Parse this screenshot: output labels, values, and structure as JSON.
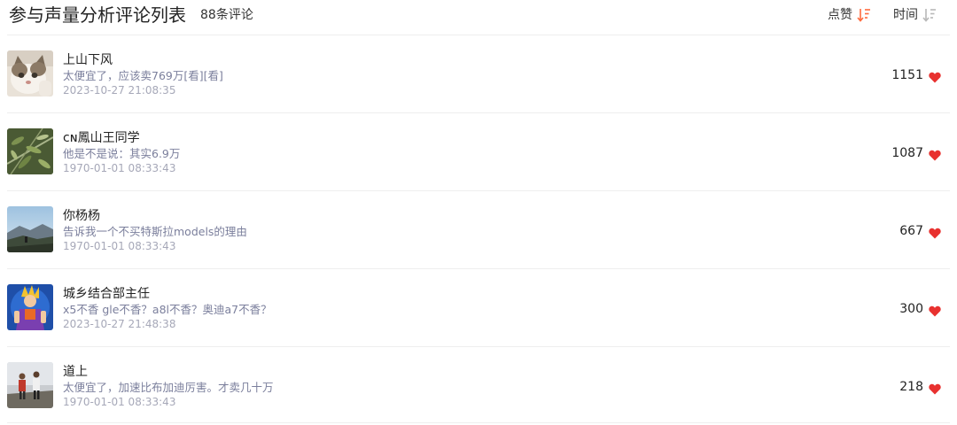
{
  "header": {
    "title": "参与声量分析评论列表",
    "count": "88条评论",
    "sort_likes_label": "点赞",
    "sort_time_label": "时间",
    "sort_likes_icon": "sort-descending-icon",
    "sort_time_icon": "sort-descending-icon",
    "active_sort_color": "#ff6a3d",
    "inactive_sort_color": "#b8b8b8"
  },
  "comments": [
    {
      "user": "上山下风",
      "text": "太便宜了，应该卖769万[看][看]",
      "time": "2023-10-27 21:08:35",
      "likes": "1151",
      "avatar": "cat-photo-avatar"
    },
    {
      "user": "ᴄɴ鳳山王同学",
      "text": "他是不是说：其实6.9万",
      "time": "1970-01-01 08:33:43",
      "likes": "1087",
      "avatar": "plant-leaves-avatar"
    },
    {
      "user": "你杨杨",
      "text": "告诉我一个不买特斯拉models的理由",
      "time": "1970-01-01 08:33:43",
      "likes": "667",
      "avatar": "mountain-landscape-avatar"
    },
    {
      "user": "城乡结合部主任",
      "text": "x5不香 gle不香？a8l不香？奥迪a7不香？",
      "time": "2023-10-27 21:48:38",
      "likes": "300",
      "avatar": "anime-figure-avatar"
    },
    {
      "user": "道上",
      "text": "太便宜了，加速比布加迪厉害。才卖几十万",
      "time": "1970-01-01 08:33:43",
      "likes": "218",
      "avatar": "two-people-outdoors-avatar"
    }
  ],
  "colors": {
    "heart": "#e8312f",
    "comment_text": "#7b7f9c",
    "timestamp": "#a6a8b8"
  }
}
